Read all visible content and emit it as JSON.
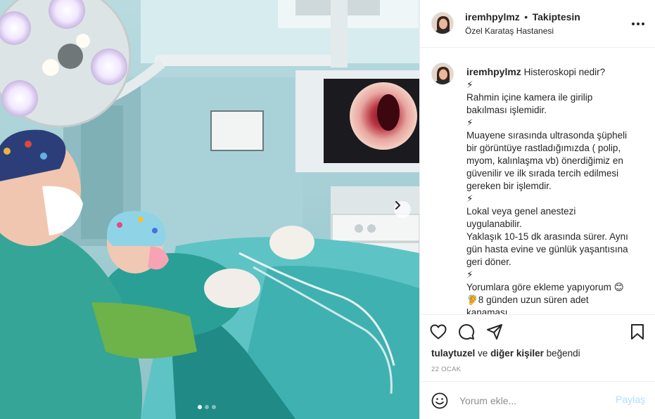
{
  "post": {
    "username": "iremhpylmz",
    "separator": "•",
    "follow_state": "Takiptesin",
    "location": "Özel Karataş Hastanesi"
  },
  "caption": {
    "username": "iremhpylmz",
    "lines": [
      "Histeroskopi nedir?",
      "⚡",
      "Rahmin içine kamera ile girilip",
      "bakılması işlemidir.",
      "⚡",
      "Muayene sırasında ultrasonda şüpheli",
      "bir görüntüye rastladığımızda ( polip,",
      "myom, kalınlaşma vb) önerdiğimiz en",
      "güvenilir ve ilk sırada tercih edilmesi",
      "gereken bir işlemdir.",
      "⚡",
      "Lokal veya genel anestezi",
      "uygulanabilir.",
      "Yaklaşık 10-15 dk arasında sürer. Aynı",
      "gün hasta evine ve günlük yaşantısına",
      "geri döner.",
      "⚡",
      "Yorumlara göre ekleme yapıyorum 😊",
      "🦻8 günden uzun süren adet",
      "kanaması"
    ]
  },
  "likes": {
    "user": "tulaytuzel",
    "connector": "ve",
    "others": "diğer kişiler",
    "suffix": "beğendi"
  },
  "date": "22 OCAK",
  "comment": {
    "placeholder": "Yorum ekle...",
    "post_label": "Paylaş"
  },
  "carousel": {
    "total_slides": 3,
    "active_slide": 1
  },
  "icons": {
    "more": "more-horizontal-icon",
    "like": "heart-icon",
    "comment": "comment-bubble-icon",
    "share": "paper-plane-icon",
    "save": "bookmark-icon",
    "emoji": "smiley-icon",
    "next": "chevron-right-icon"
  },
  "colors": {
    "post_button_disabled": "#b3dbff",
    "scrub_teal": "#2fa59c",
    "border": "#efefef"
  }
}
